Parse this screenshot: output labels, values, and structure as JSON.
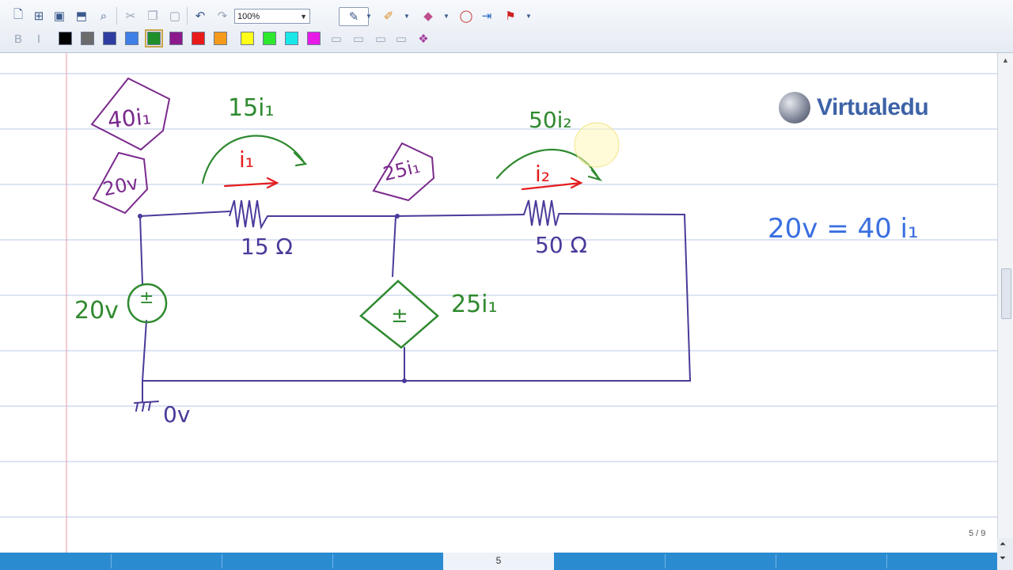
{
  "toolbar": {
    "zoom_value": "100%",
    "icons_row1": [
      "new-page-icon",
      "add-page-icon",
      "save-icon",
      "open-icon",
      "find-icon",
      "cut-icon",
      "copy-icon",
      "paste-icon",
      "undo-icon",
      "redo-icon"
    ],
    "tools": [
      "pen-tool-icon",
      "highlighter-icon",
      "eraser-icon",
      "lasso-icon",
      "insert-space-icon",
      "pointer-icon"
    ],
    "colors": [
      "#000000",
      "#6b6b6b",
      "#2f3da0",
      "#3f7fe8",
      "#1f8f2a",
      "#8c1a8c",
      "#e81a1a",
      "#f59a1a",
      "#ffff1a",
      "#2ee82e",
      "#1ae8e8",
      "#e81ae8"
    ],
    "selected_color": "#1f8f2a"
  },
  "page": {
    "brand": "Virtualedu",
    "page_indicator": "5 / 9",
    "current_page": "5"
  },
  "notes": {
    "label_40i1": "40i₁",
    "label_20v_node": "20v",
    "label_15i1": "15i₁",
    "label_i1": "i₁",
    "label_25i1_node": "25i₁",
    "label_50i2": "50i₂",
    "label_i2": "i₂",
    "label_15ohm": "15 Ω",
    "label_50ohm": "50 Ω",
    "label_20v_source": "20v",
    "label_25i1_source": "25i₁",
    "label_0v": "0v",
    "equation": "20v = 40 i₁"
  },
  "colors": {
    "wire": "#4b3a9a",
    "note_purple": "#7a2a8c",
    "note_green": "#2f8a2f",
    "note_red": "#e41e1e",
    "note_blue": "#3a6fe0",
    "grid_line": "#b8c8e8",
    "margin_line": "#e89aa6"
  }
}
